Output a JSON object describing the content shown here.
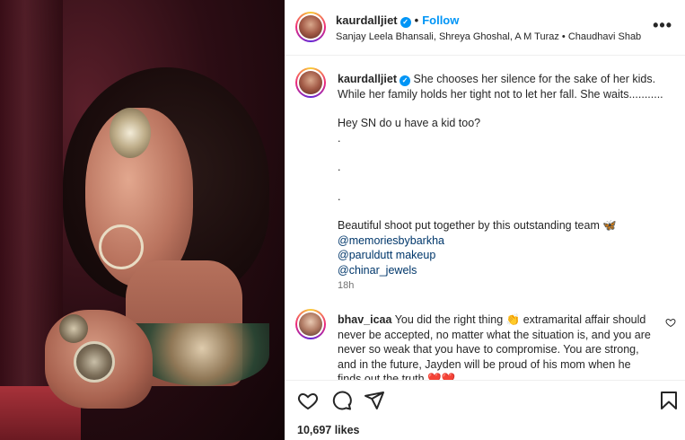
{
  "post": {
    "username": "kaurdalljiet",
    "verified_glyph": "✓",
    "dot": "•",
    "follow_label": "Follow",
    "audio_text": "Sanjay Leela Bhansali, Shreya Ghoshal, A M Turaz • Chaudhavi Shab",
    "more_label": "•••"
  },
  "caption": {
    "username": "kaurdalljiet",
    "line1": "She chooses her silence for the sake of her kids. While her family holds her tight not to let her fall. She waits...........",
    "line2": "Hey SN do u have a kid too?",
    "dot1": ".",
    "dot2": ".",
    "dot3": ".",
    "line3": "Beautiful shoot put together by this outstanding team 🦋",
    "mentions": [
      "@memoriesbybarkha",
      "@paruldutt makeup",
      "@chinar_jewels"
    ],
    "time": "18h"
  },
  "comment": {
    "username": "bhav_icaa",
    "text": "You did the right thing 👏 extramarital affair should never be accepted, no matter what the situation is, and you are never so weak that you have to compromise. You are strong, and in the future, Jayden will be proud of his mom when he finds out the truth ❤️❤️"
  },
  "actions": {
    "like_icon": "heart-icon",
    "comment_icon": "comment-icon",
    "share_icon": "share-icon",
    "save_icon": "bookmark-icon"
  },
  "likes": "10,697 likes",
  "colors": {
    "link_blue": "#0095f6",
    "mention_blue": "#00376b",
    "muted": "#737373",
    "text": "#262626"
  }
}
